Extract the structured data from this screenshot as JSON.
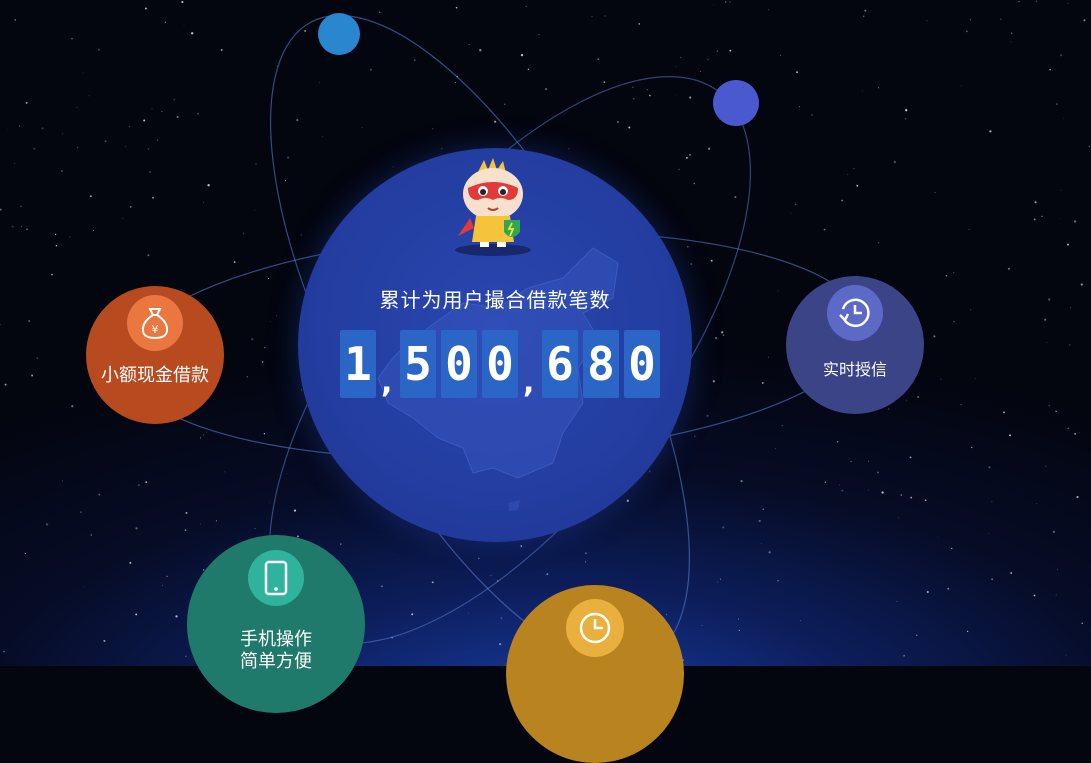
{
  "stats": {
    "label": "累计为用户撮合借款笔数",
    "count_display": [
      "1",
      ",",
      "5",
      "0",
      "0",
      ",",
      "6",
      "8",
      "0"
    ]
  },
  "features": {
    "small_loan": {
      "label": "小额现金借款",
      "icon": "money-bag-icon"
    },
    "realtime_credit": {
      "label": "实时授信",
      "icon": "clock-refresh-icon"
    },
    "mobile": {
      "label_line1": "手机操作",
      "label_line2": "简单方便",
      "icon": "phone-icon"
    },
    "fast": {
      "icon": "clock-icon"
    }
  },
  "colors": {
    "globe": "#233da0",
    "digit_bg": "#2b66c7",
    "small_loan": "#b84a20",
    "realtime": "#3c4488",
    "mobile": "#1f7a6c",
    "fast": "#b98420"
  }
}
